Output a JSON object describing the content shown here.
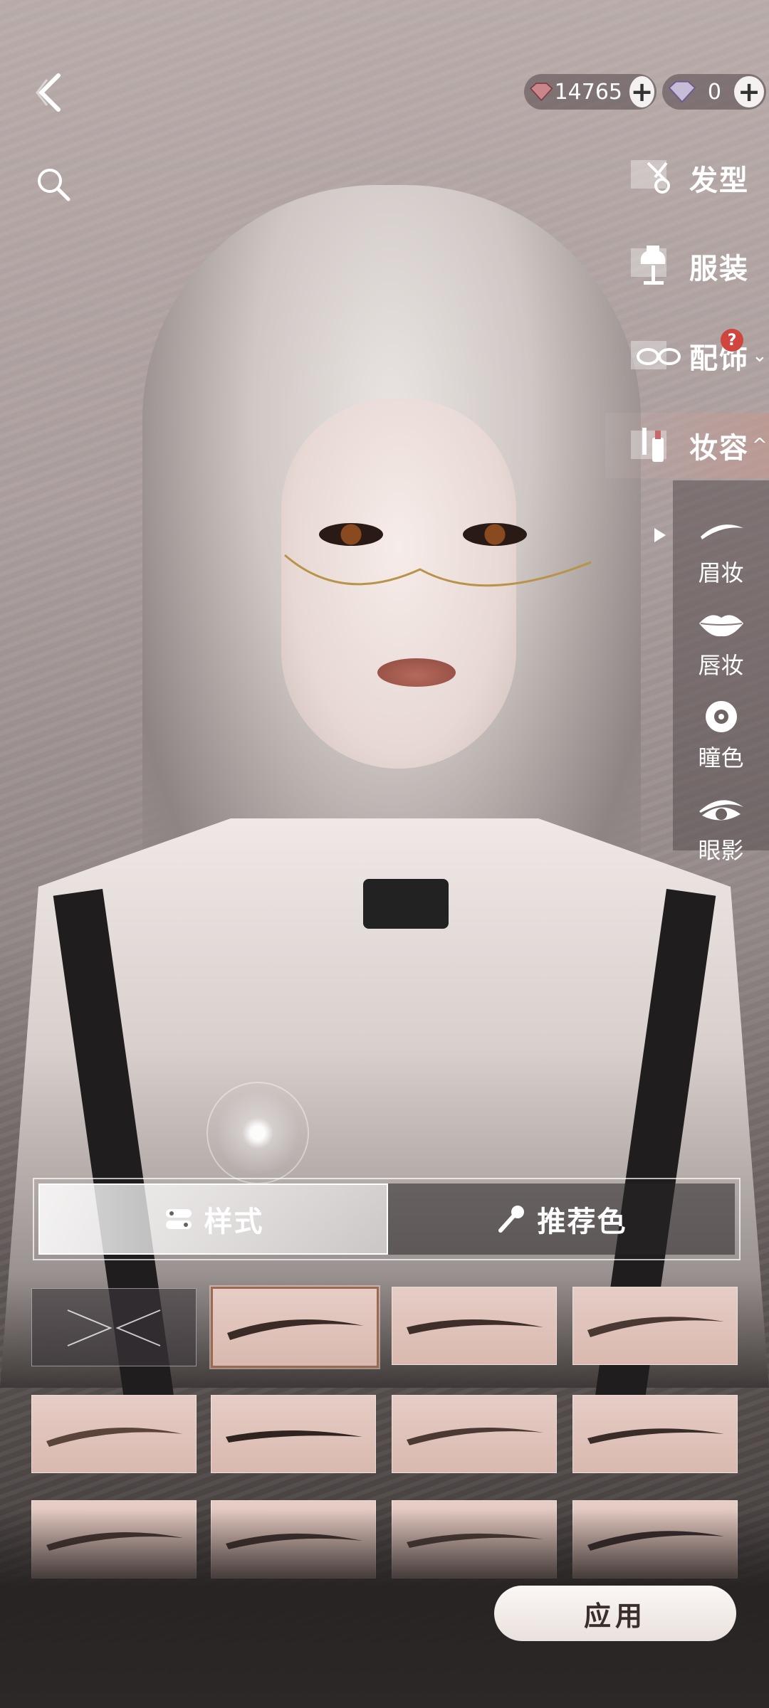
{
  "currency": [
    {
      "icon": "red-gem-icon",
      "amount": "14765"
    },
    {
      "icon": "purple-gem-icon",
      "amount": "0"
    }
  ],
  "categories": [
    {
      "label": "发型",
      "icon": "hair-scissors-icon"
    },
    {
      "label": "服装",
      "icon": "mannequin-icon"
    },
    {
      "label": "配饰",
      "icon": "glasses-icon",
      "badge": "?",
      "chevron": "⌄"
    },
    {
      "label": "妆容",
      "icon": "makeup-icon",
      "chevron": "^"
    }
  ],
  "makeup_sub": [
    {
      "label": "眉妆",
      "icon": "eyebrow-icon"
    },
    {
      "label": "唇妆",
      "icon": "lips-icon"
    },
    {
      "label": "瞳色",
      "icon": "pupil-icon"
    },
    {
      "label": "眼影",
      "icon": "eyeshadow-icon"
    }
  ],
  "tabs": [
    {
      "label": "样式",
      "icon": "style-icon"
    },
    {
      "label": "推荐色",
      "icon": "brush-icon"
    }
  ],
  "apply_label": "应用",
  "accent": "#9b6a55"
}
